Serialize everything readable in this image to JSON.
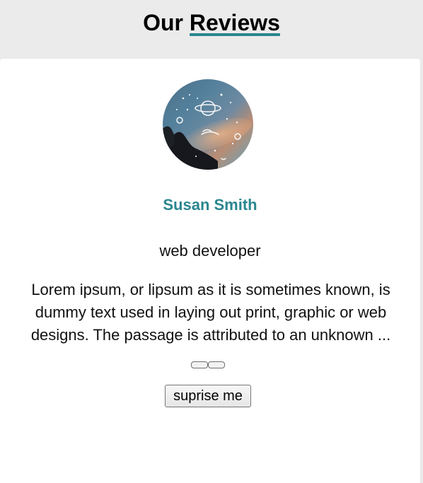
{
  "header": {
    "title_prefix": "Our",
    "title_accent": "Reviews"
  },
  "review": {
    "author": "Susan Smith",
    "job": "web developer",
    "info": "Lorem ipsum, or lipsum as it is sometimes known, is dummy text used in laying out print, graphic or web designs. The passage is attributed to an unknown ..."
  },
  "controls": {
    "prev_icon": "prev-icon",
    "next_icon": "next-icon"
  },
  "actions": {
    "random_label": "suprise me"
  },
  "colors": {
    "accent": "#2a868f",
    "background": "#ebebeb",
    "card": "#ffffff"
  },
  "icons": {
    "avatar": "planet-sky-avatar-icon"
  }
}
